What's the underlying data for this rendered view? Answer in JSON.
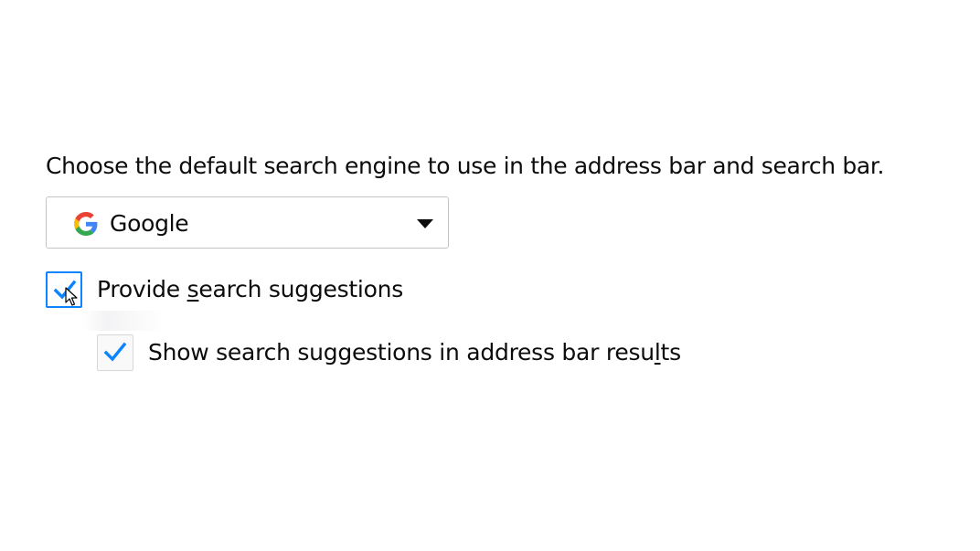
{
  "search": {
    "description": "Choose the default search engine to use in the address bar and search bar.",
    "engine": {
      "selected": "Google",
      "icon": "google-g-icon"
    },
    "suggestions": {
      "label_before": "Provide ",
      "label_access_key": "s",
      "label_after": "earch suggestions",
      "checked": true
    },
    "address_bar_suggestions": {
      "label_before": "Show search suggestions in address bar resu",
      "label_access_key": "l",
      "label_after": "ts",
      "checked": true
    }
  },
  "colors": {
    "accent": "#0a84ff",
    "check": "#0a84ff",
    "text": "#0c0c0d"
  }
}
